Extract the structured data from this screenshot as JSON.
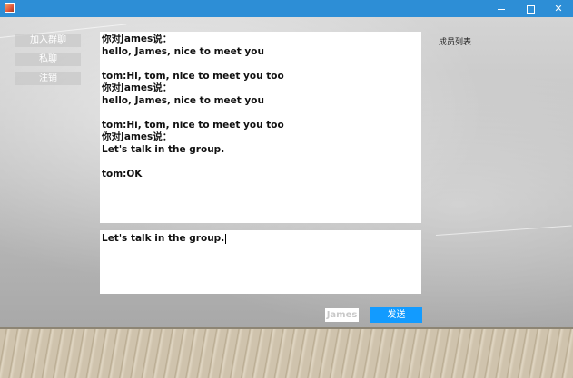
{
  "window": {
    "controls": {
      "minimize_icon": "minimize-icon",
      "maximize_icon": "maximize-icon",
      "close_symbol": "✕"
    },
    "colors": {
      "titlebar": "#2d8ed6",
      "send_button": "#129bff"
    }
  },
  "sidebar": {
    "buttons": [
      {
        "label": "加入群聊"
      },
      {
        "label": "私聊"
      },
      {
        "label": "注销"
      }
    ]
  },
  "chat": {
    "lines": [
      "你对James说：",
      "hello, James, nice to meet you",
      "",
      "tom:Hi, tom, nice to meet you too",
      "你对James说：",
      "hello, James, nice to meet you",
      "",
      "tom:Hi, tom, nice to meet you too",
      "你对James说：",
      "Let's talk in the group.",
      "",
      "tom:OK"
    ]
  },
  "input": {
    "value": "Let's talk in the group."
  },
  "members": {
    "title": "成员列表"
  },
  "footer": {
    "name_value": "James",
    "send_label": "发送"
  }
}
